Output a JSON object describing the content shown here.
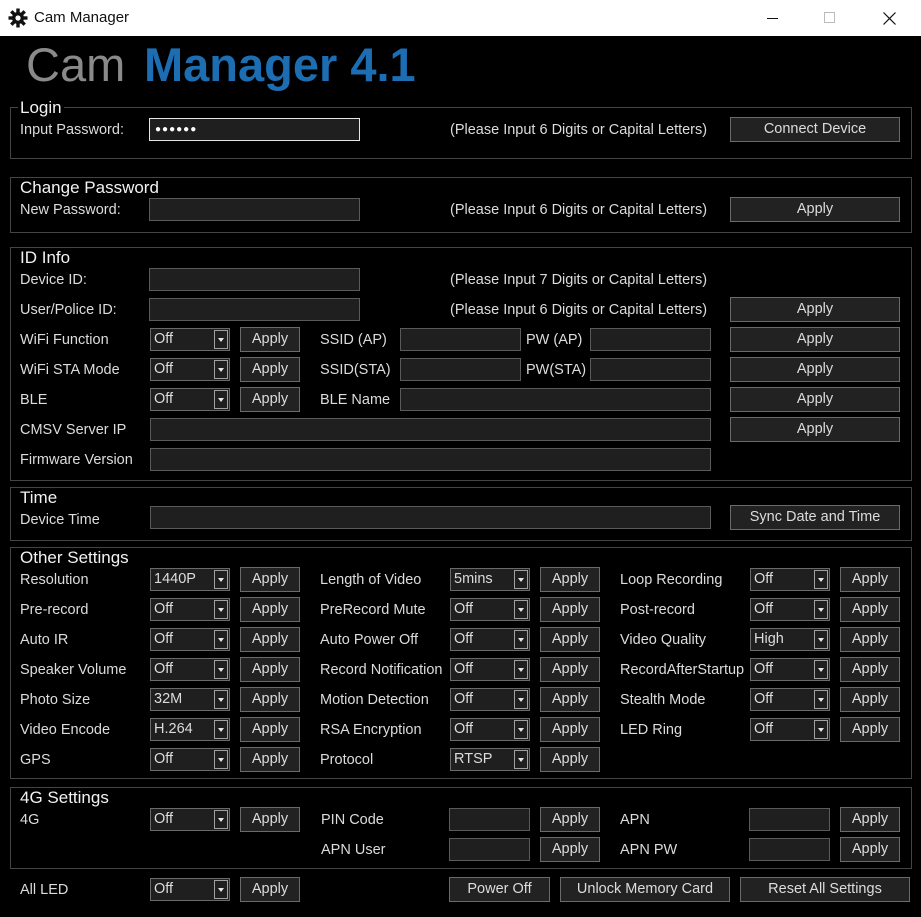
{
  "window": {
    "title": "Cam Manager"
  },
  "banner": {
    "part1": "Cam ",
    "part2": "Manager 4.1",
    "color1": "#8a8a8a",
    "color2": "#1d6db3"
  },
  "login": {
    "title": "Login",
    "label": "Input Password:",
    "value": "●●●●●●",
    "hint": "(Please Input 6 Digits or Capital Letters)",
    "button": "Connect Device"
  },
  "change_pw": {
    "title": "Change Password",
    "label": "New Password:",
    "hint": "(Please Input 6 Digits or Capital Letters)",
    "button": "Apply"
  },
  "id_info": {
    "title": "ID Info",
    "device_id": {
      "label": "Device ID:",
      "hint": "(Please Input 7 Digits or Capital Letters)"
    },
    "user_id": {
      "label": "User/Police ID:",
      "hint": "(Please Input 6 Digits or Capital Letters)",
      "button": "Apply"
    },
    "wifi": {
      "label": "WiFi Function",
      "value": "Off",
      "apply": "Apply",
      "ssid_label": "SSID (AP)",
      "pw_label": "PW (AP)",
      "button": "Apply"
    },
    "wifi_sta": {
      "label": "WiFi STA Mode",
      "value": "Off",
      "apply": "Apply",
      "ssid_label": "SSID(STA)",
      "pw_label": "PW(STA)",
      "button": "Apply"
    },
    "ble": {
      "label": "BLE",
      "value": "Off",
      "apply": "Apply",
      "name_label": "BLE Name",
      "button": "Apply"
    },
    "cmsv": {
      "label": "CMSV Server IP",
      "button": "Apply"
    },
    "firmware": {
      "label": "Firmware Version"
    }
  },
  "time": {
    "title": "Time",
    "label": "Device Time",
    "button": "Sync Date and Time"
  },
  "other": {
    "title": "Other Settings",
    "col1": [
      {
        "label": "Resolution",
        "value": "1440P",
        "apply": "Apply"
      },
      {
        "label": "Pre-record",
        "value": "Off",
        "apply": "Apply"
      },
      {
        "label": "Auto IR",
        "value": "Off",
        "apply": "Apply"
      },
      {
        "label": "Speaker Volume",
        "value": "Off",
        "apply": "Apply"
      },
      {
        "label": "Photo Size",
        "value": "32M",
        "apply": "Apply"
      },
      {
        "label": "Video Encode",
        "value": "H.264",
        "apply": "Apply"
      },
      {
        "label": "GPS",
        "value": "Off",
        "apply": "Apply"
      }
    ],
    "col2": [
      {
        "label": "Length of Video",
        "value": "5mins",
        "apply": "Apply"
      },
      {
        "label": "PreRecord Mute",
        "value": "Off",
        "apply": "Apply"
      },
      {
        "label": "Auto Power Off",
        "value": "Off",
        "apply": "Apply"
      },
      {
        "label": "Record Notification",
        "value": "Off",
        "apply": "Apply"
      },
      {
        "label": "Motion Detection",
        "value": "Off",
        "apply": "Apply"
      },
      {
        "label": "RSA Encryption",
        "value": "Off",
        "apply": "Apply"
      },
      {
        "label": "Protocol",
        "value": "RTSP",
        "apply": "Apply"
      }
    ],
    "col3": [
      {
        "label": "Loop Recording",
        "value": "Off",
        "apply": "Apply"
      },
      {
        "label": "Post-record",
        "value": "Off",
        "apply": "Apply"
      },
      {
        "label": "Video Quality",
        "value": "High",
        "apply": "Apply"
      },
      {
        "label": "RecordAfterStartup",
        "value": "Off",
        "apply": "Apply"
      },
      {
        "label": "Stealth Mode",
        "value": "Off",
        "apply": "Apply"
      },
      {
        "label": "LED Ring",
        "value": "Off",
        "apply": "Apply"
      }
    ]
  },
  "g4": {
    "title": "4G Settings",
    "g4": {
      "label": "4G",
      "value": "Off",
      "apply": "Apply"
    },
    "pin": {
      "label": "PIN Code",
      "apply": "Apply"
    },
    "apn": {
      "label": "APN",
      "apply": "Apply"
    },
    "apn_user": {
      "label": "APN User",
      "apply": "Apply"
    },
    "apn_pw": {
      "label": "APN PW",
      "apply": "Apply"
    }
  },
  "footer": {
    "all_led": {
      "label": "All LED",
      "value": "Off",
      "apply": "Apply"
    },
    "power_off": "Power Off",
    "unlock": "Unlock Memory Card",
    "reset": "Reset All Settings"
  }
}
